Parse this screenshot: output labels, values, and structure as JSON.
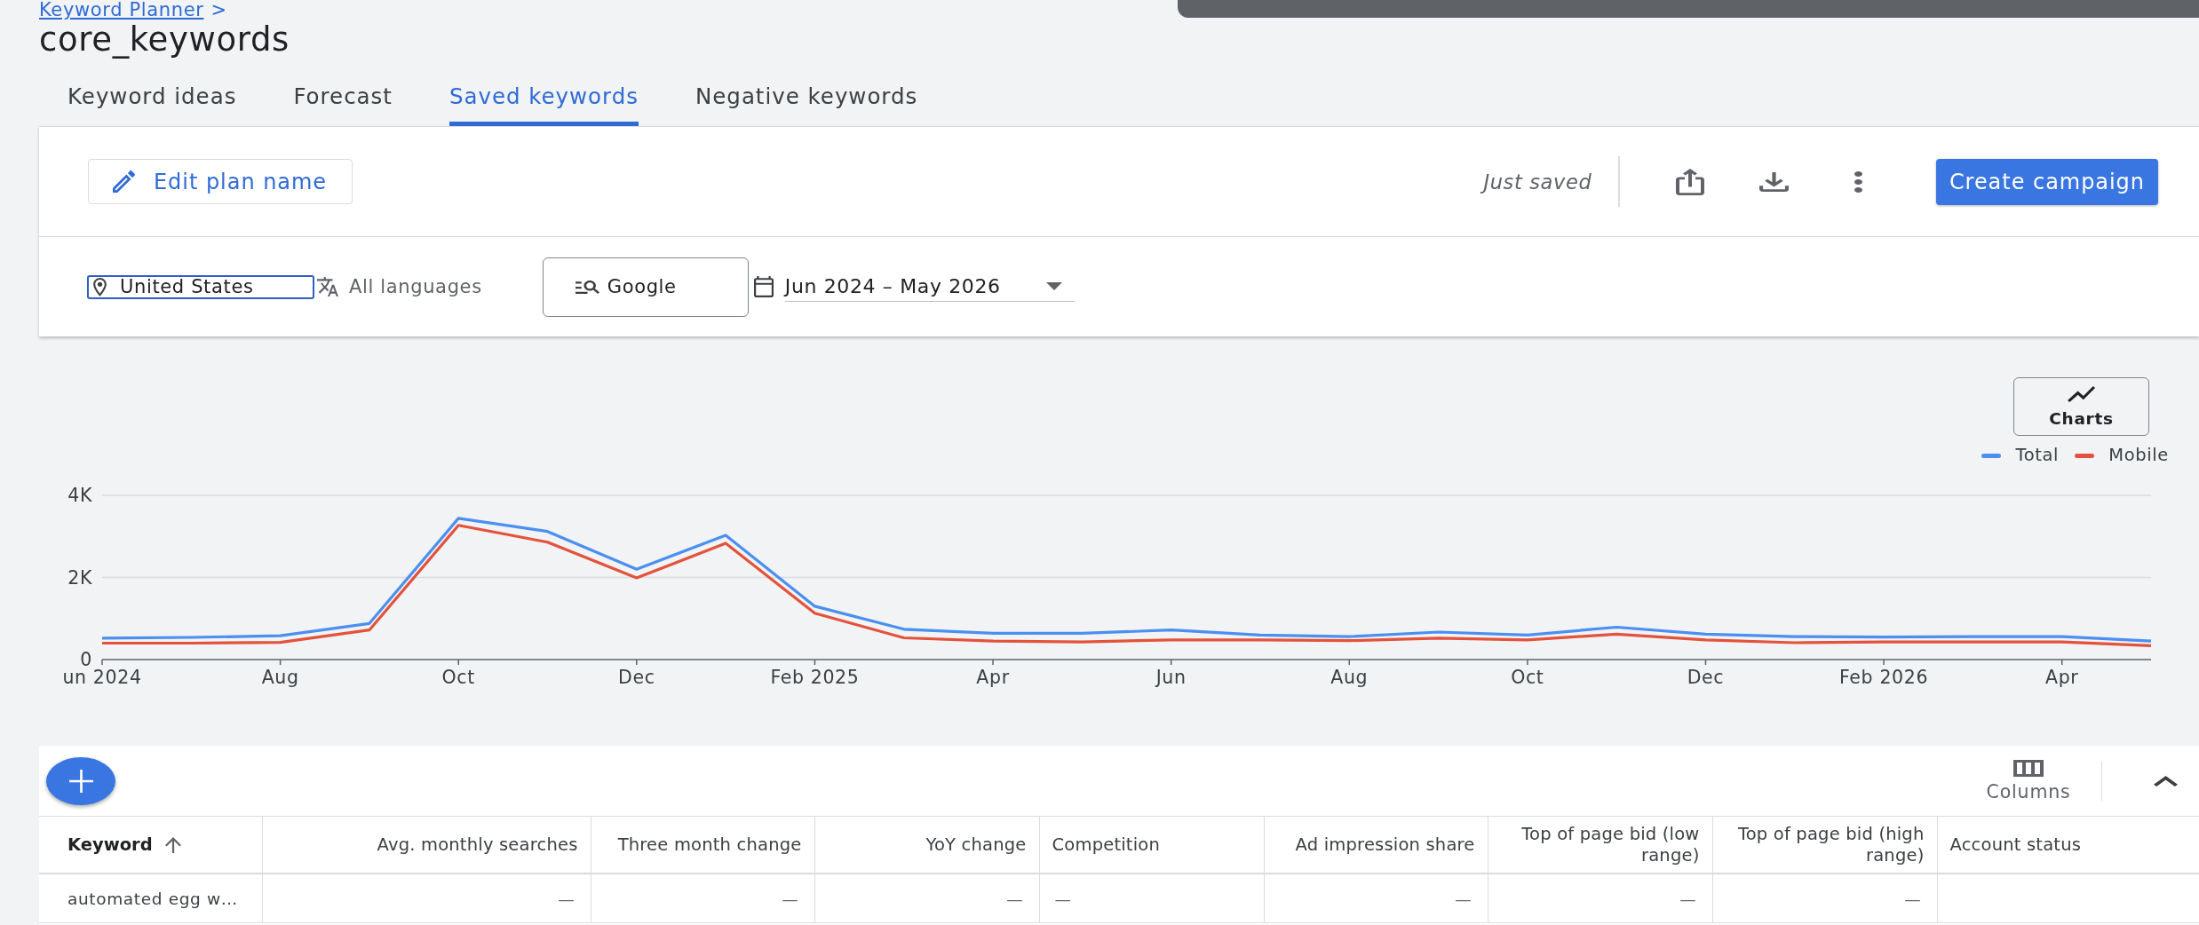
{
  "breadcrumb": {
    "link": "Keyword Planner",
    "separator": ">"
  },
  "title": "core_keywords",
  "tabs": [
    {
      "label": "Keyword ideas",
      "selected": false
    },
    {
      "label": "Forecast",
      "selected": false
    },
    {
      "label": "Saved keywords",
      "selected": true
    },
    {
      "label": "Negative keywords",
      "selected": false
    }
  ],
  "toolbar": {
    "edit_button": "Edit plan name",
    "save_status": "Just saved",
    "primary_button": "Create campaign"
  },
  "filters": {
    "location": {
      "value": "United States",
      "focused": true
    },
    "language": "All languages",
    "network": "Google",
    "date_range": "Jun 2024 – May 2026"
  },
  "chart": {
    "button": "Charts",
    "chart_data": {
      "type": "line",
      "legend": "top-right",
      "categories": [
        "un 2024",
        null,
        "Aug",
        null,
        "Oct",
        null,
        "Dec",
        null,
        "Feb 2025",
        null,
        "Apr",
        null,
        "Jun",
        null,
        "Aug",
        null,
        "Oct",
        null,
        "Dec",
        null,
        "Feb 2026",
        null,
        "Apr",
        null
      ],
      "ylim": [
        0,
        4000
      ],
      "yticks": [
        {
          "value": 0,
          "label": "0"
        },
        {
          "value": 2000,
          "label": "2K"
        },
        {
          "value": 4000,
          "label": "4K"
        }
      ],
      "series": [
        {
          "name": "Total",
          "color": "#4b8ff0",
          "values": [
            520,
            540,
            580,
            880,
            3440,
            3120,
            2200,
            3030,
            1300,
            740,
            640,
            640,
            720,
            600,
            560,
            670,
            600,
            790,
            620,
            560,
            550,
            560,
            560,
            450
          ]
        },
        {
          "name": "Mobile",
          "color": "#e4523b",
          "values": [
            400,
            400,
            420,
            720,
            3270,
            2860,
            1990,
            2830,
            1130,
            530,
            450,
            430,
            480,
            480,
            460,
            520,
            480,
            620,
            480,
            410,
            430,
            430,
            430,
            340
          ]
        }
      ]
    }
  },
  "table": {
    "columns_button": "Columns",
    "expanded": true,
    "columns": [
      {
        "label": "Keyword",
        "kind": "text",
        "sorted": true
      },
      {
        "label": "Avg. monthly searches",
        "kind": "metric",
        "sorted": false
      },
      {
        "label": "Three month change",
        "kind": "metric",
        "sorted": false
      },
      {
        "label": "YoY change",
        "kind": "metric",
        "sorted": false
      },
      {
        "label": "Competition",
        "kind": "text",
        "sorted": false
      },
      {
        "label": "Ad impression share",
        "kind": "metric",
        "sorted": false
      },
      {
        "label": "Top of page bid (low range)",
        "kind": "metric",
        "sorted": false
      },
      {
        "label": "Top of page bid (high range)",
        "kind": "metric",
        "sorted": false
      },
      {
        "label": "Account status",
        "kind": "text",
        "sorted": false
      }
    ],
    "rows": [
      {
        "cells": [
          "automated egg w…",
          "—",
          "—",
          "—",
          "—",
          "—",
          "—",
          "—"
        ]
      }
    ]
  }
}
